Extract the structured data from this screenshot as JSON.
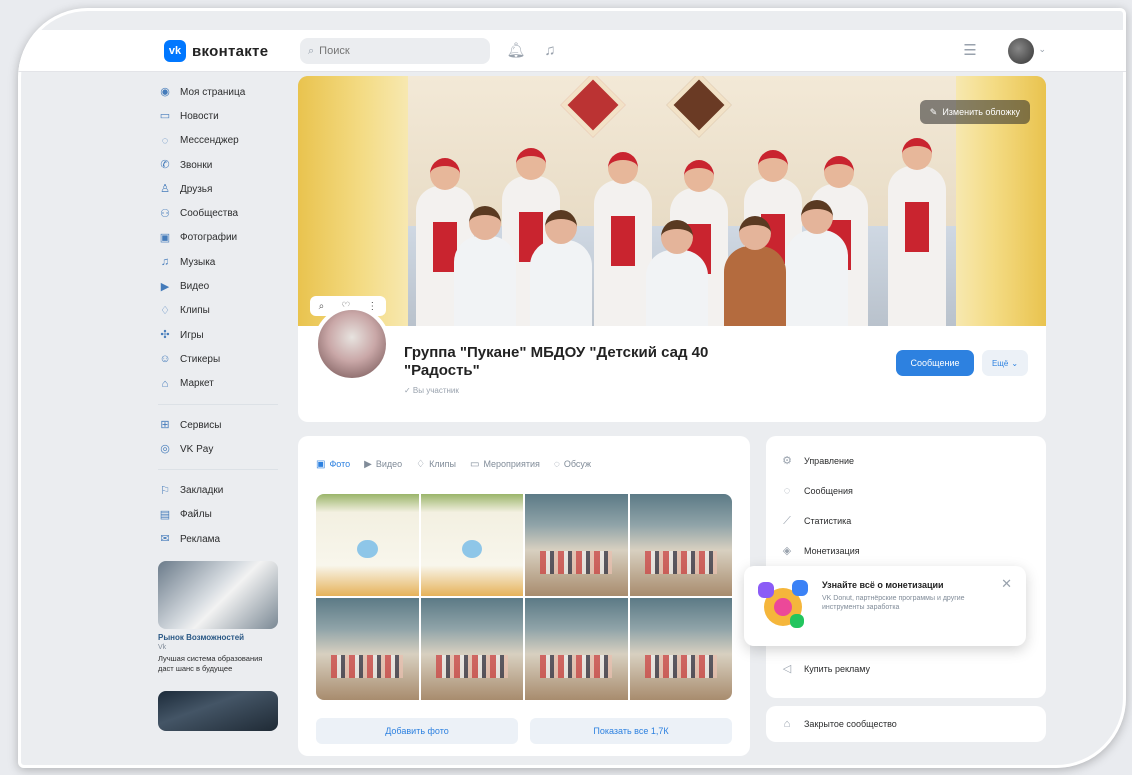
{
  "topbar": {
    "logo_mark": "vk",
    "logo_text": "вконтакте",
    "search_placeholder": "Поиск",
    "icons": [
      "bell-icon",
      "music-icon",
      "menu-icon"
    ]
  },
  "nav": {
    "items": [
      {
        "label": "Моя страница",
        "icon": "user-icon",
        "glyph": "◉"
      },
      {
        "label": "Новости",
        "icon": "news-icon",
        "glyph": "▭"
      },
      {
        "label": "Мессенджер",
        "icon": "chat-icon",
        "glyph": "◌"
      },
      {
        "label": "Звонки",
        "icon": "phone-icon",
        "glyph": "✆"
      },
      {
        "label": "Друзья",
        "icon": "friends-icon",
        "glyph": "♙"
      },
      {
        "label": "Сообщества",
        "icon": "groups-icon",
        "glyph": "⚇"
      },
      {
        "label": "Фотографии",
        "icon": "photo-icon",
        "glyph": "▣"
      },
      {
        "label": "Музыка",
        "icon": "music-icon",
        "glyph": "♫"
      },
      {
        "label": "Видео",
        "icon": "video-icon",
        "glyph": "▶"
      },
      {
        "label": "Клипы",
        "icon": "clips-icon",
        "glyph": "♢"
      },
      {
        "label": "Игры",
        "icon": "games-icon",
        "glyph": "✣"
      },
      {
        "label": "Стикеры",
        "icon": "stickers-icon",
        "glyph": "☺"
      },
      {
        "label": "Маркет",
        "icon": "market-icon",
        "glyph": "⌂"
      }
    ],
    "items2": [
      {
        "label": "Сервисы",
        "icon": "services-icon",
        "glyph": "⊞"
      },
      {
        "label": "VK Pay",
        "icon": "vkpay-icon",
        "glyph": "◎"
      }
    ],
    "items3": [
      {
        "label": "Закладки",
        "icon": "bookmark-icon",
        "glyph": "⚐"
      },
      {
        "label": "Файлы",
        "icon": "files-icon",
        "glyph": "▤"
      },
      {
        "label": "Реклама",
        "icon": "ads-icon",
        "glyph": "✉"
      }
    ],
    "ad": {
      "title": "Рынок Возможностей",
      "sub": "Vk",
      "text": "Лучшая система образования даст шанс в будущее"
    }
  },
  "cover": {
    "edit_label": "Изменить обложку",
    "tools": [
      "⌕",
      "♡",
      "⋮"
    ]
  },
  "group": {
    "title": "Группа \"Пукане\" МБДОУ \"Детский сад 40 \"Радость\"",
    "subtitle": "✓ Вы участник",
    "message_button": "Сообщение",
    "more_button": "Ещё"
  },
  "content": {
    "tabs": [
      {
        "label": "Фото",
        "glyph": "▣",
        "active": true
      },
      {
        "label": "Видео",
        "glyph": "▶",
        "active": false
      },
      {
        "label": "Клипы",
        "glyph": "♢",
        "active": false
      },
      {
        "label": "Мероприятия",
        "glyph": "▭",
        "active": false
      },
      {
        "label": "Обсуж",
        "glyph": "◌",
        "active": false
      }
    ],
    "photos": [
      "cert",
      "cert",
      "room",
      "room",
      "room",
      "room",
      "room",
      "room"
    ],
    "add_photo": "Добавить фото",
    "show_all": "Показать все 1,7К"
  },
  "manage": {
    "items": [
      {
        "label": "Управление",
        "icon": "settings-icon",
        "glyph": "⚙"
      },
      {
        "label": "Сообщения",
        "icon": "message-icon",
        "glyph": "◌"
      },
      {
        "label": "Статистика",
        "icon": "stats-icon",
        "glyph": "⟋"
      },
      {
        "label": "Монетизация",
        "icon": "money-icon",
        "glyph": "◈"
      }
    ],
    "last_item": {
      "label": "Купить рекламу",
      "icon": "megaphone-icon",
      "glyph": "◁"
    },
    "closed": {
      "label": "Закрытое сообщество",
      "icon": "lock-icon",
      "glyph": "⌂"
    }
  },
  "popup": {
    "title": "Узнайте всё о монетизации",
    "text": "VK Donut, партнёрские программы и другие инструменты заработка",
    "close": "✕"
  }
}
